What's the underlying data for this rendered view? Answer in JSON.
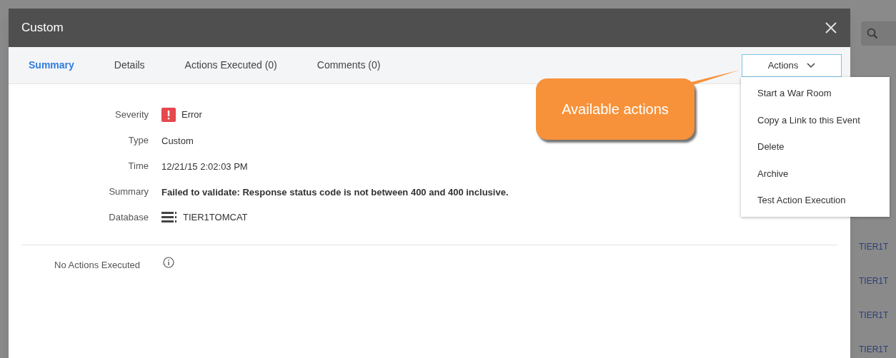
{
  "dialog": {
    "title": "Custom"
  },
  "tabs": [
    {
      "label": "Summary",
      "selected": true
    },
    {
      "label": "Details",
      "selected": false
    },
    {
      "label": "Actions Executed (0)",
      "selected": false
    },
    {
      "label": "Comments (0)",
      "selected": false
    }
  ],
  "actions_button": {
    "label": "Actions"
  },
  "actions_menu": [
    "Start a War Room",
    "Copy a Link to this Event",
    "Delete",
    "Archive",
    "Test Action Execution"
  ],
  "callout": "Available actions",
  "fields": [
    {
      "label": "Severity",
      "value": "Error",
      "kind": "severity"
    },
    {
      "label": "Type",
      "value": "Custom",
      "kind": "text"
    },
    {
      "label": "Time",
      "value": "12/21/15 2:02:03 PM",
      "kind": "text"
    },
    {
      "label": "Summary",
      "value": "Failed to validate: Response status code is not between 400 and 400 inclusive.",
      "kind": "bold"
    },
    {
      "label": "Database",
      "value": "TIER1TOMCAT",
      "kind": "database"
    }
  ],
  "actions_executed": {
    "label": "No Actions Executed"
  },
  "background_list": [
    "TIER1T",
    "TIER1T",
    "TIER1T",
    "TIER1T"
  ]
}
